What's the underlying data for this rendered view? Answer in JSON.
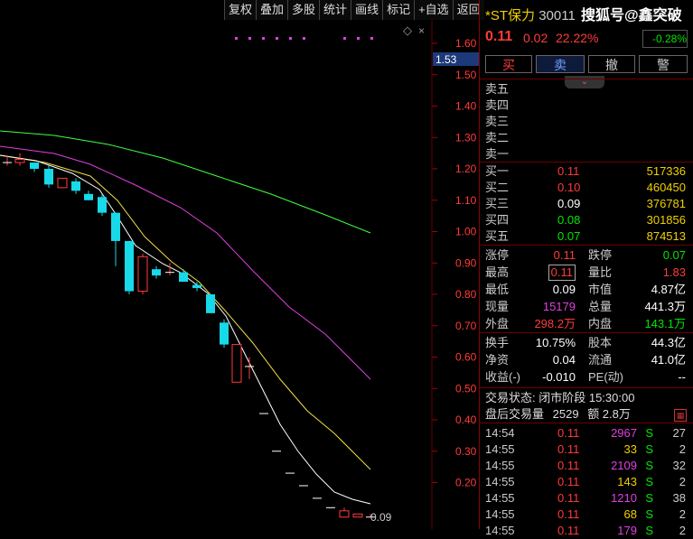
{
  "toolbar": [
    "复权",
    "叠加",
    "多股",
    "统计",
    "画线",
    "标记",
    "+自选",
    "返回"
  ],
  "chart": {
    "price_tag": "1.53",
    "last_label": "0.09",
    "axis_ticks": [
      "1.60",
      "1.50",
      "1.40",
      "1.30",
      "1.20",
      "1.10",
      "1.00",
      "0.90",
      "0.80",
      "0.70",
      "0.60",
      "0.50",
      "0.40",
      "0.30",
      "0.20"
    ],
    "ma_colors": {
      "ma1": "#ffffff",
      "ma2": "#f0e040",
      "ma3": "#e040e0",
      "ma4": "#40ff40"
    },
    "up_color": "#ff3b3b",
    "down_color": "#18d9e8"
  },
  "header": {
    "name": "*ST保力",
    "code": "30011",
    "watermark": "搜狐号@鑫突破",
    "price": "0.11",
    "change": "0.02",
    "change_pct": "22.22%",
    "badge": "-0.28%"
  },
  "actions": {
    "buy": "买",
    "sell": "卖",
    "cancel": "撤",
    "alert": "警"
  },
  "sell_levels": [
    "卖五",
    "卖四",
    "卖三",
    "卖二",
    "卖一"
  ],
  "buy_levels": [
    {
      "label": "买一",
      "price": "0.11",
      "vol": "517336"
    },
    {
      "label": "买二",
      "price": "0.10",
      "vol": "460450"
    },
    {
      "label": "买三",
      "price": "0.09",
      "vol": "376781"
    },
    {
      "label": "买四",
      "price": "0.08",
      "vol": "301856"
    },
    {
      "label": "买五",
      "price": "0.07",
      "vol": "874513"
    }
  ],
  "stats": [
    {
      "l1": "涨停",
      "v1": "0.11",
      "l2": "跌停",
      "v2": "0.07"
    },
    {
      "l1": "最高",
      "v1": "0.11",
      "l2": "量比",
      "v2": "1.83"
    },
    {
      "l1": "最低",
      "v1": "0.09",
      "l2": "市值",
      "v2": "4.87亿"
    },
    {
      "l1": "现量",
      "v1": "15179",
      "l2": "总量",
      "v2": "441.3万"
    },
    {
      "l1": "外盘",
      "v1": "298.2万",
      "l2": "内盘",
      "v2": "143.1万"
    }
  ],
  "stats2": [
    {
      "l1": "换手",
      "v1": "10.75%",
      "l2": "股本",
      "v2": "44.3亿"
    },
    {
      "l1": "净资",
      "v1": "0.04",
      "l2": "流通",
      "v2": "41.0亿"
    },
    {
      "l1": "收益(-)",
      "v1": "-0.010",
      "l2": "PE(动)",
      "v2": "--"
    }
  ],
  "status": {
    "line1": "交易状态: 闭市阶段 15:30:00",
    "line2a": "盘后交易量",
    "line2b": "2529",
    "line2c": "额 2.8万"
  },
  "ticks": [
    {
      "t": "14:54",
      "p": "0.11",
      "v": "2967",
      "s": "S",
      "n": "27"
    },
    {
      "t": "14:55",
      "p": "0.11",
      "v": "33",
      "s": "S",
      "n": "2"
    },
    {
      "t": "14:55",
      "p": "0.11",
      "v": "2109",
      "s": "S",
      "n": "32"
    },
    {
      "t": "14:55",
      "p": "0.11",
      "v": "143",
      "s": "S",
      "n": "2"
    },
    {
      "t": "14:55",
      "p": "0.11",
      "v": "1210",
      "s": "S",
      "n": "38"
    },
    {
      "t": "14:55",
      "p": "0.11",
      "v": "68",
      "s": "S",
      "n": "2"
    },
    {
      "t": "14:55",
      "p": "0.11",
      "v": "179",
      "s": "S",
      "n": "2"
    }
  ]
}
